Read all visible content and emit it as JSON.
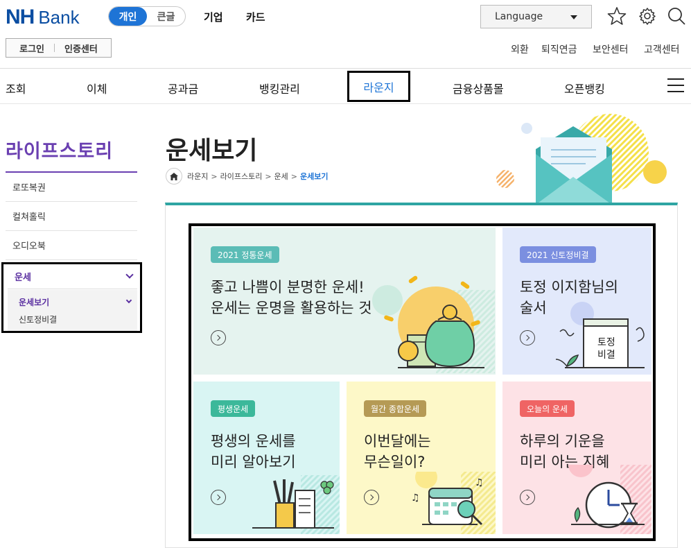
{
  "header": {
    "logo_nh": "NH",
    "logo_bank": "Bank",
    "size_personal": "개인",
    "size_large": "큰글",
    "top_links": [
      "기업",
      "카드"
    ],
    "language": "Language",
    "login": "로그인",
    "cert_center": "인증센터",
    "util_links": [
      "외환",
      "퇴직연금",
      "보안센터",
      "고객센터"
    ]
  },
  "nav": {
    "items": [
      "조회",
      "이체",
      "공과금",
      "뱅킹관리",
      "라운지",
      "금융상품몰",
      "오픈뱅킹"
    ]
  },
  "sidebar": {
    "title": "라이프스토리",
    "items": [
      "로또복권",
      "컬쳐홀릭",
      "오디오북"
    ],
    "section": "운세",
    "sub_active": "운세보기",
    "sub_other": "신토정비결"
  },
  "main": {
    "title": "운세보기",
    "breadcrumb": [
      "라운지",
      "라이프스토리",
      "운세",
      "운세보기"
    ]
  },
  "cards": [
    {
      "badge": "2021 정통운세",
      "line1": "좋고 나쁨이 분명한 운세!",
      "line2": "운세는 운명을 활용하는 것",
      "color": "#5bbcb6"
    },
    {
      "badge": "2021 신토정비결",
      "line1": "토정 이지함님의",
      "line2": "술서",
      "color": "#7b8fe0"
    },
    {
      "badge": "평생운세",
      "line1": "평생의 운세를",
      "line2": "미리 알아보기",
      "color": "#3cb89a"
    },
    {
      "badge": "월간 종합운세",
      "line1": "이번달에는",
      "line2": "무슨일이?",
      "color": "#b59a55"
    },
    {
      "badge": "오늘의 운세",
      "line1": "하루의 기운을",
      "line2": "미리 아는 지혜",
      "color": "#ef6464"
    }
  ],
  "illustration_labels": {
    "book_line1": "토정",
    "book_line2": "비결"
  },
  "colors": {
    "brand_blue": "#0b4ea2",
    "accent_blue": "#1e74d6",
    "purple": "#6a3fb1",
    "teal": "#2fa5a3"
  }
}
